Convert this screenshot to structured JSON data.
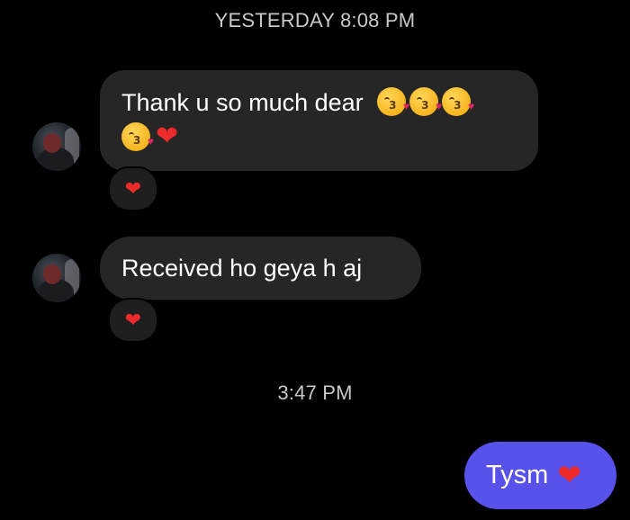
{
  "thread": {
    "timestamp_1": "YESTERDAY 8:08 PM",
    "timestamp_2": "3:47 PM"
  },
  "messages": [
    {
      "direction": "incoming",
      "text": "Thank u so much dear",
      "emojis": [
        "kissing-face-icon",
        "kissing-face-icon",
        "kissing-face-icon",
        "kissing-face-icon",
        "red-heart-icon"
      ],
      "reaction": "❤"
    },
    {
      "direction": "incoming",
      "text": "Received ho geya h aj",
      "reaction": "❤"
    },
    {
      "direction": "outgoing",
      "text": "Tysm",
      "emoji": "❤"
    }
  ],
  "colors": {
    "background": "#000000",
    "incoming_bubble": "#262626",
    "outgoing_bubble": "#5851ea",
    "heart": "#ed2b2b"
  }
}
